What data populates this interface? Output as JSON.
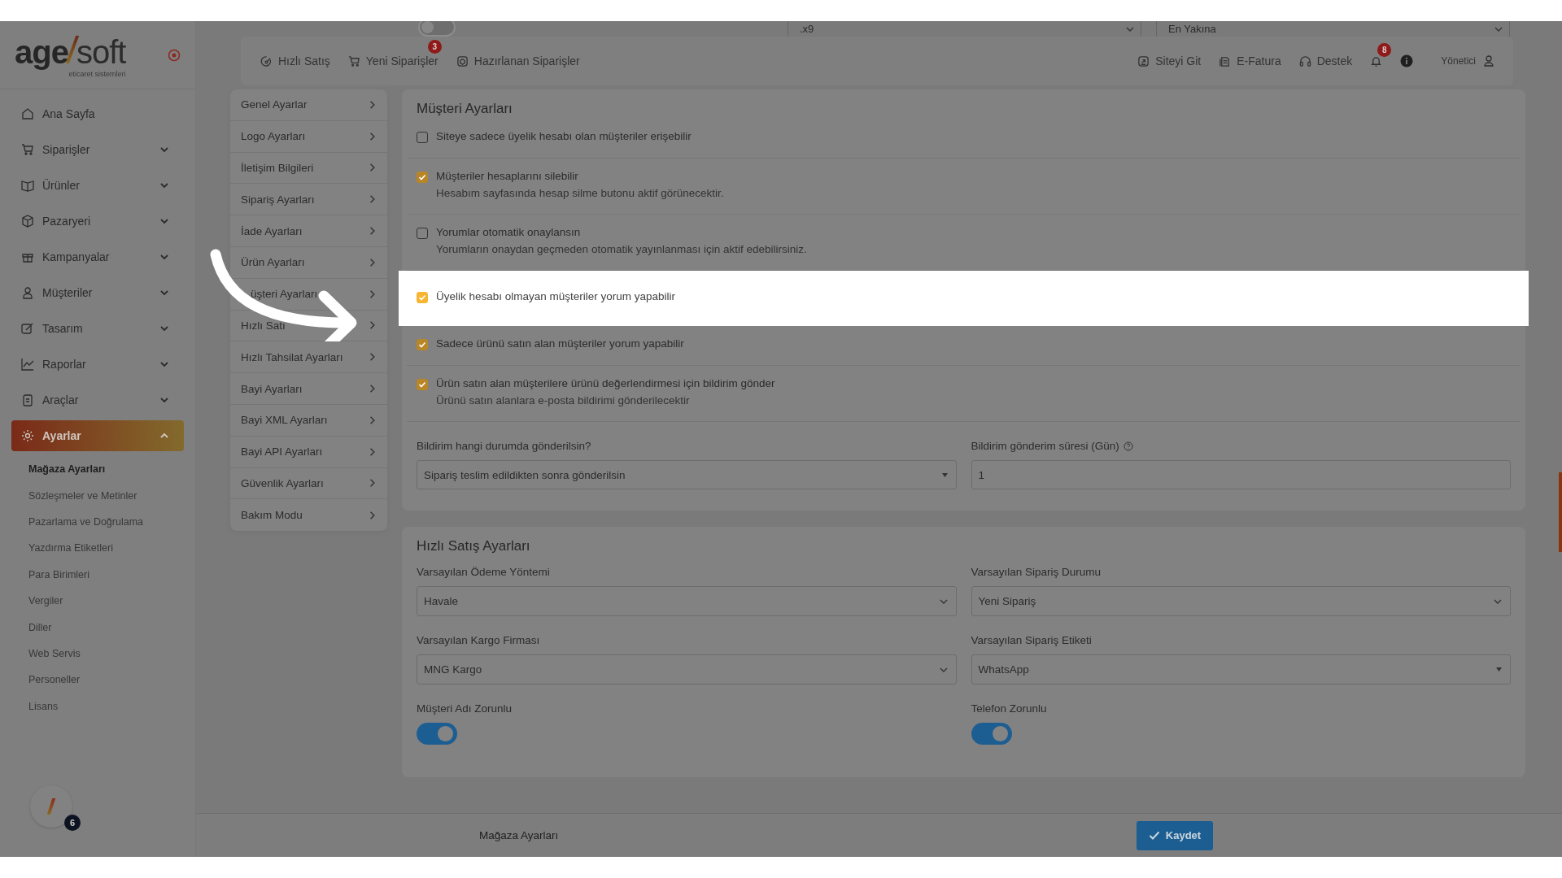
{
  "brand": {
    "logo_dark": "age",
    "logo_light": "soft",
    "tagline": "eticaret sistemleri"
  },
  "top_partial": {
    "toggle_on": false,
    "select_1": ".x9",
    "select_2": "En Yakına"
  },
  "topbar": {
    "left": [
      {
        "label": "Hızlı Satış"
      },
      {
        "label": "Yeni Siparişler",
        "badge": "3"
      },
      {
        "label": "Hazırlanan Siparişler"
      }
    ],
    "right": [
      {
        "label": "Siteyi Git"
      },
      {
        "label": "E-Fatura"
      },
      {
        "label": "Destek"
      }
    ],
    "notifications_badge": "8",
    "user": "Yönetici"
  },
  "sidebar": {
    "items": [
      {
        "label": "Ana Sayfa",
        "selected": false
      },
      {
        "label": "Siparişler",
        "selected": false,
        "expanded": false
      },
      {
        "label": "Ürünler",
        "selected": false,
        "expanded": false
      },
      {
        "label": "Pazaryeri",
        "selected": false,
        "expanded": false
      },
      {
        "label": "Kampanyalar",
        "selected": false,
        "expanded": false
      },
      {
        "label": "Müşteriler",
        "selected": false,
        "expanded": false
      },
      {
        "label": "Tasarım",
        "selected": false,
        "expanded": false
      },
      {
        "label": "Raporlar",
        "selected": false,
        "expanded": false
      },
      {
        "label": "Araçlar",
        "selected": false,
        "expanded": false
      },
      {
        "label": "Ayarlar",
        "selected": true,
        "expanded": true,
        "children": [
          {
            "label": "Mağaza Ayarları",
            "selected": true
          },
          {
            "label": "Sözleşmeler ve Metinler",
            "selected": false
          },
          {
            "label": "Pazarlama ve Doğrulama",
            "selected": false
          },
          {
            "label": "Yazdırma Etiketleri",
            "selected": false
          },
          {
            "label": "Para Birimleri",
            "selected": false
          },
          {
            "label": "Vergiler",
            "selected": false
          },
          {
            "label": "Diller",
            "selected": false
          },
          {
            "label": "Web Servis",
            "selected": false
          },
          {
            "label": "Personeller",
            "selected": false
          },
          {
            "label": "Lisans",
            "selected": false
          }
        ]
      }
    ],
    "avatar_badge": "6"
  },
  "settings_menu": [
    "Genel Ayarlar",
    "Logo Ayarları",
    "İletişim Bilgileri",
    "Sipariş Ayarları",
    "İade Ayarları",
    "Ürün Ayarları",
    "üşteri Ayarları",
    "Hızlı Satı",
    "Hızlı Tahsilat Ayarları",
    "Bayi Ayarları",
    "Bayi XML Ayarları",
    "Bayi API Ayarları",
    "Güvenlik Ayarları",
    "Bakım Modu"
  ],
  "customer_settings": {
    "title": "Müşteri Ayarları",
    "options": [
      {
        "label": "Siteye sadece üyelik hesabı olan müşteriler erişebilir",
        "checked": false,
        "highlighted": false
      },
      {
        "label": "Müşteriler hesaplarını silebilir",
        "hint": "Hesabım sayfasında hesap silme butonu aktif görünecektir.",
        "checked": true,
        "highlighted": false
      },
      {
        "label": "Yorumlar otomatik onaylansın",
        "hint": "Yorumların onaydan geçmeden otomatik yayınlanması için aktif edebilirsiniz.",
        "checked": false,
        "highlighted": false
      },
      {
        "label": "Üyelik hesabı olmayan müşteriler yorum yapabilir",
        "checked": true,
        "highlighted": true
      },
      {
        "label": "Sadece ürünü satın alan müşteriler yorum yapabilir",
        "checked": true,
        "highlighted": false
      },
      {
        "label": "Ürün satın alan müşterilere ürünü değerlendirmesi için bildirim gönder",
        "hint": "Ürünü satın alanlara e-posta bildirimi gönderilecektir",
        "checked": true,
        "highlighted": false
      }
    ],
    "notify_when": {
      "label": "Bildirim hangi durumda gönderilsin?",
      "value": "Sipariş teslim edildikten sonra gönderilsin"
    },
    "notify_days": {
      "label": "Bildirim gönderim süresi (Gün)",
      "value": "1"
    }
  },
  "quick_sale": {
    "title": "Hızlı Satış Ayarları",
    "selects": [
      {
        "label": "Varsayılan Ödeme Yöntemi",
        "value": "Havale"
      },
      {
        "label": "Varsayılan Sipariş Durumu",
        "value": "Yeni Sipariş"
      },
      {
        "label": "Varsayılan Kargo Firması",
        "value": "MNG Kargo"
      },
      {
        "label": "Varsayılan Sipariş Etiketi",
        "value": "WhatsApp"
      }
    ],
    "toggles": [
      {
        "label": "Müşteri Adı Zorunlu",
        "on": true
      },
      {
        "label": "Telefon Zorunlu",
        "on": true
      }
    ]
  },
  "footer": {
    "breadcrumb": "Mağaza Ayarları",
    "save": "Kaydet"
  }
}
